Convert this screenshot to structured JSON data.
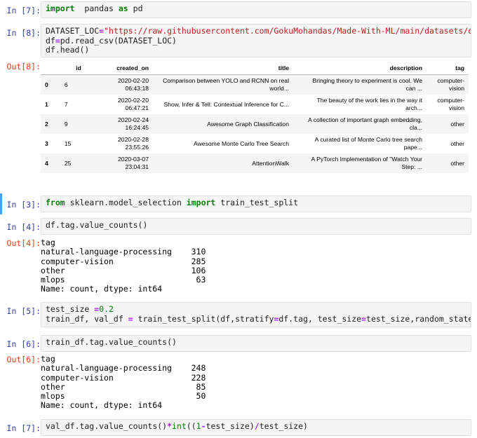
{
  "cells": [
    {
      "prompt": "In [7]:",
      "lines": [
        [
          [
            "kw",
            "import"
          ],
          [
            "",
            "  pandas "
          ],
          [
            "kw",
            "as"
          ],
          [
            "",
            " pd"
          ]
        ]
      ]
    },
    {
      "prompt": "In [8]:",
      "out_prompt": "Out[8]:",
      "lines": [
        [
          [
            "",
            "DATASET_LOC"
          ],
          [
            "op",
            "="
          ],
          [
            "str",
            "\"https://raw.githubusercontent.com/GokuMohandas/Made-With-ML/main/datasets/datase"
          ]
        ],
        [
          [
            "",
            "df"
          ],
          [
            "op",
            "="
          ],
          [
            "",
            "pd.read_csv(DATASET_LOC)"
          ]
        ],
        [
          [
            "",
            "df.head()"
          ]
        ]
      ]
    },
    {
      "prompt": "In [3]:",
      "lines": [
        [
          [
            "kw",
            "from"
          ],
          [
            "",
            " sklearn.model_selection "
          ],
          [
            "kw",
            "import"
          ],
          [
            "",
            " train_test_split"
          ]
        ]
      ]
    },
    {
      "prompt": "In [4]:",
      "out_prompt": "Out[4]:",
      "lines": [
        [
          [
            "",
            "df.tag.value_counts()"
          ]
        ]
      ]
    },
    {
      "prompt": "In [5]:",
      "lines": [
        [
          [
            "",
            "test_size "
          ],
          [
            "op",
            "="
          ],
          [
            "num",
            "0.2"
          ]
        ],
        [
          [
            "",
            "train_df, val_df "
          ],
          [
            "op",
            "="
          ],
          [
            "",
            " train_test_split(df,stratify"
          ],
          [
            "op",
            "="
          ],
          [
            "",
            "df.tag, test_size"
          ],
          [
            "op",
            "="
          ],
          [
            "",
            "test_size,random_state"
          ],
          [
            "op",
            "="
          ],
          [
            "num",
            "1234"
          ]
        ]
      ]
    },
    {
      "prompt": "In [6]:",
      "out_prompt": "Out[6]:",
      "lines": [
        [
          [
            "",
            "train_df.tag.value_counts()"
          ]
        ]
      ]
    },
    {
      "prompt": "In [7]:",
      "lines": [
        [
          [
            "",
            "val_df.tag.value_counts()"
          ],
          [
            "op",
            "*"
          ],
          [
            "bi",
            "int"
          ],
          [
            "",
            "(("
          ],
          [
            "num",
            "1"
          ],
          [
            "op",
            "-"
          ],
          [
            "",
            "test_size)"
          ],
          [
            "op",
            "/"
          ],
          [
            "",
            "test_size)"
          ]
        ]
      ]
    }
  ],
  "dataframe": {
    "columns": [
      "id",
      "created_on",
      "title",
      "description",
      "tag"
    ],
    "rows": [
      {
        "index": "0",
        "id": "6",
        "created_on": [
          "2020-02-20",
          "06:43:18"
        ],
        "title": [
          "Comparison between YOLO and RCNN on real",
          "world..."
        ],
        "description": [
          "Bringing theory to experiment is cool. We",
          "can ..."
        ],
        "tag": [
          "computer-",
          "vision"
        ]
      },
      {
        "index": "1",
        "id": "7",
        "created_on": [
          "2020-02-20",
          "06:47:21"
        ],
        "title": [
          "Show, Infer & Tell: Contextual Inference for C..."
        ],
        "description": [
          "The beauty of the work lies in the way it",
          "arch..."
        ],
        "tag": [
          "computer-",
          "vision"
        ]
      },
      {
        "index": "2",
        "id": "9",
        "created_on": [
          "2020-02-24",
          "16:24:45"
        ],
        "title": [
          "Awesome Graph Classification"
        ],
        "description": [
          "A collection of important graph embedding,",
          "cla..."
        ],
        "tag": [
          "other"
        ]
      },
      {
        "index": "3",
        "id": "15",
        "created_on": [
          "2020-02-28",
          "23:55:26"
        ],
        "title": [
          "Awesome Monte Carlo Tree Search"
        ],
        "description": [
          "A curated list of Monte Carlo tree search",
          "pape..."
        ],
        "tag": [
          "other"
        ]
      },
      {
        "index": "4",
        "id": "25",
        "created_on": [
          "2020-03-07",
          "23:04:31"
        ],
        "title": [
          "AttentionWalk"
        ],
        "description": [
          "A PyTorch Implementation of \"Watch Your",
          "Step: ..."
        ],
        "tag": [
          "other"
        ]
      }
    ]
  },
  "out4": "tag\nnatural-language-processing    310\ncomputer-vision                285\nother                          106\nmlops                           63\nName: count, dtype: int64",
  "out6": "tag\nnatural-language-processing    248\ncomputer-vision                228\nother                           85\nmlops                           50\nName: count, dtype: int64"
}
